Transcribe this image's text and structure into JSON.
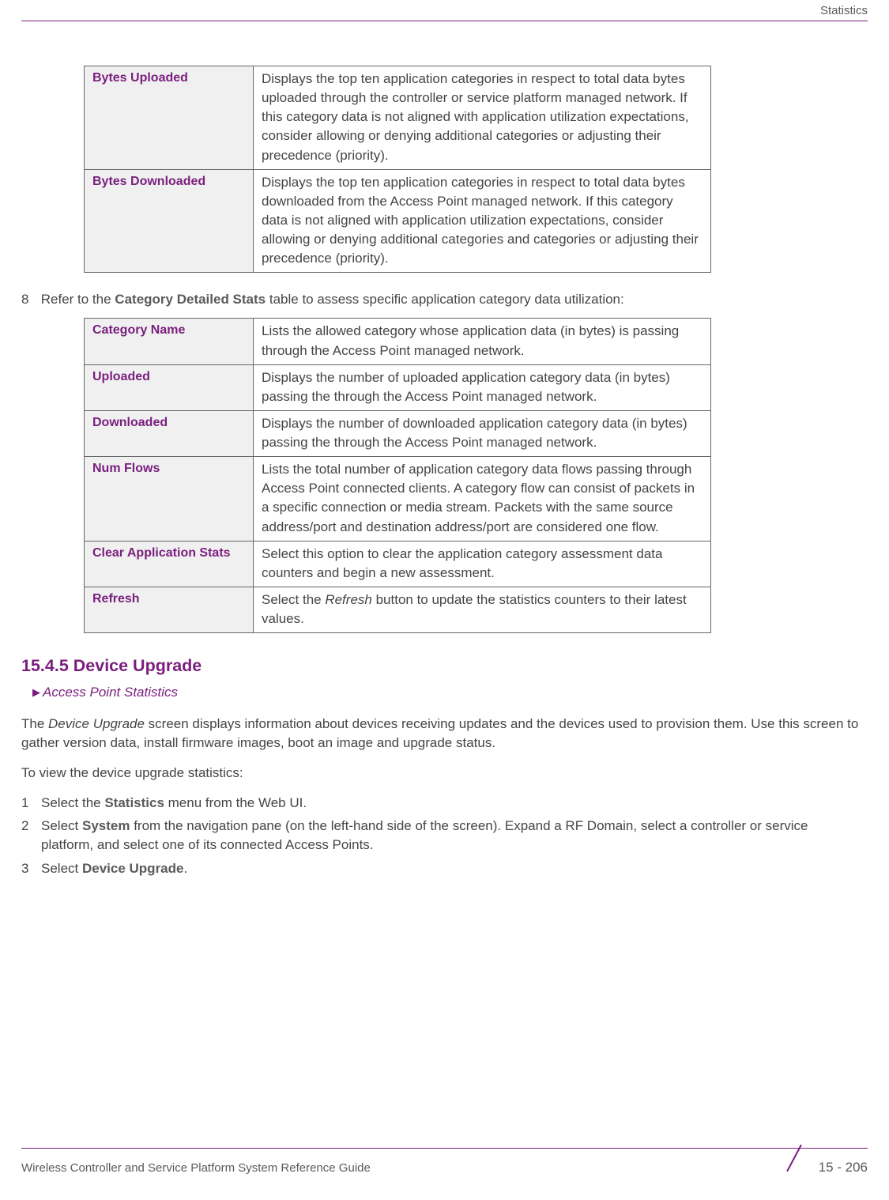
{
  "header": {
    "label": "Statistics"
  },
  "table1": {
    "rows": [
      {
        "label": "Bytes Uploaded",
        "desc": "Displays the top ten application categories in respect to total data bytes uploaded through the controller or service platform managed network. If this category data is not aligned with application utilization expectations, consider allowing or denying additional categories or adjusting their precedence (priority)."
      },
      {
        "label": "Bytes Downloaded",
        "desc": "Displays the top ten application categories in respect to total data bytes downloaded from the Access Point managed network. If this category data is not aligned with application utilization expectations, consider allowing or denying additional categories and categories or adjusting their precedence (priority)."
      }
    ]
  },
  "step8": {
    "num": "8",
    "pre": "Refer to the ",
    "bold": "Category Detailed Stats",
    "post": " table to assess specific application category data utilization:"
  },
  "table2": {
    "rows": [
      {
        "label": "Category Name",
        "desc": "Lists the allowed category whose application data (in bytes) is passing through the Access Point managed network."
      },
      {
        "label": "Uploaded",
        "desc": "Displays the number of uploaded application category data (in bytes) passing the through the Access Point managed network."
      },
      {
        "label": "Downloaded",
        "desc": "Displays the number of downloaded application category data (in bytes) passing the through the Access Point managed network."
      },
      {
        "label": "Num Flows",
        "desc": "Lists the total number of application category data flows passing through Access Point connected clients. A category flow can consist of packets in a specific connection or media stream. Packets with the same source address/port and destination address/port are considered one flow."
      },
      {
        "label": "Clear Application Stats",
        "desc": "Select this option to clear the application category assessment data counters and begin a new assessment."
      },
      {
        "label": "Refresh",
        "desc_pre": "Select the ",
        "desc_italic": "Refresh",
        "desc_post": " button to update the statistics counters to their latest values."
      }
    ]
  },
  "section": {
    "heading": "15.4.5 Device Upgrade",
    "breadcrumb": "Access Point Statistics",
    "para1_pre": "The ",
    "para1_italic": "Device Upgrade",
    "para1_post": " screen displays information about devices receiving updates and the devices used to provision them. Use this screen to gather version data, install firmware images, boot an image and upgrade status.",
    "para2": "To view the device upgrade statistics:"
  },
  "steps": [
    {
      "n": "1",
      "pre": "Select the ",
      "bold": "Statistics",
      "post": " menu from the Web UI."
    },
    {
      "n": "2",
      "pre": "Select ",
      "bold": "System",
      "post": " from the navigation pane (on the left-hand side of the screen). Expand a RF Domain, select a controller or service platform, and select one of its connected Access Points."
    },
    {
      "n": "3",
      "pre": "Select ",
      "bold": "Device Upgrade",
      "post": "."
    }
  ],
  "footer": {
    "left": "Wireless Controller and Service Platform System Reference Guide",
    "right": "15 - 206"
  }
}
